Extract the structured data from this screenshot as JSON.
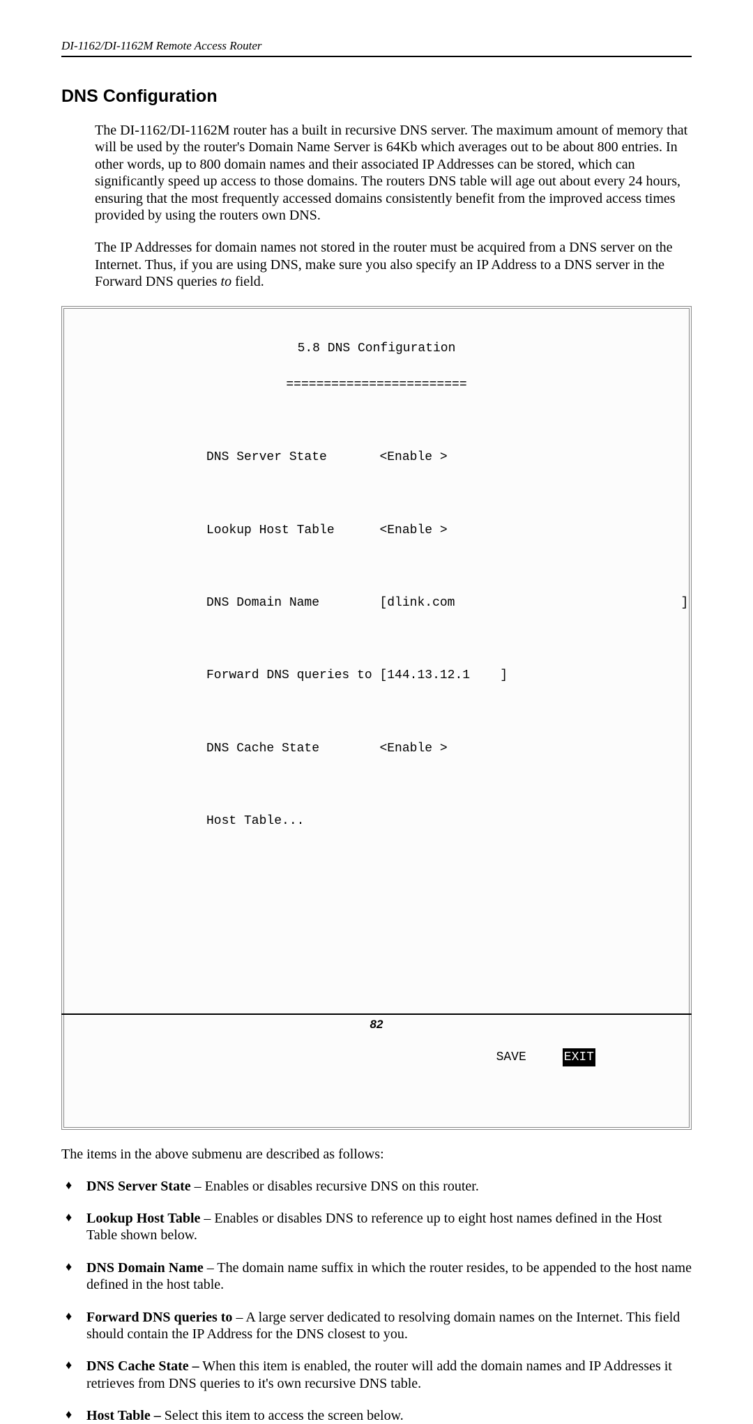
{
  "header": {
    "doc_title": "DI-1162/DI-1162M Remote Access Router"
  },
  "section": {
    "title": "DNS Configuration",
    "para1": "The DI-1162/DI-1162M router has a built in recursive DNS server. The maximum amount of memory that will be used by the router's Domain Name Server is 64Kb which averages out to be about 800 entries. In other words, up to 800 domain names and their associated IP Addresses can be stored, which can significantly speed up access to those domains. The routers DNS table will age out about every 24 hours, ensuring that the most frequently accessed domains consistently benefit from the improved access times provided by using the routers own DNS.",
    "para2_a": "The IP Addresses for domain names not stored in the router must be acquired from a DNS server on the Internet. Thus, if you are using DNS, make sure you also specify an IP Address to a DNS server in the Forward DNS queries ",
    "para2_ital": "to",
    "para2_b": " field."
  },
  "terminal": {
    "title": "5.8 DNS Configuration",
    "underline": "========================",
    "rows": {
      "server_state_label": "DNS Server State",
      "server_state_value": "<Enable >",
      "lookup_label": "Lookup Host Table",
      "lookup_value": "<Enable >",
      "domain_label": "DNS Domain Name",
      "domain_value": "[dlink.com",
      "domain_close": "]",
      "forward_label": "Forward DNS queries to",
      "forward_value": "[144.13.12.1    ]",
      "cache_label": "DNS Cache State",
      "cache_value": "<Enable >",
      "host_table": "Host Table..."
    },
    "save": "SAVE",
    "exit": "EXIT"
  },
  "after_terminal": "The items in the above submenu are described as follows:",
  "bullets": [
    {
      "bold": "DNS Server State",
      "rest": " – Enables or disables recursive DNS on this router."
    },
    {
      "bold": "Lookup Host Table",
      "rest": " – Enables or disables DNS to reference up to eight host names defined in the Host Table shown below."
    },
    {
      "bold": "DNS Domain Name",
      "rest": " – The domain name suffix in which the router resides, to be appended to the host name defined in the host table."
    },
    {
      "bold": "Forward DNS queries to",
      "rest": " – A large server dedicated to resolving domain names on the Internet. This field should contain the IP Address for the DNS closest to you."
    },
    {
      "bold": "DNS Cache State –",
      "rest": " When this item is enabled, the router will add the domain names and IP Addresses it retrieves from DNS queries to it's own recursive DNS table."
    },
    {
      "bold": "Host Table –",
      "rest": " Select this item to access the screen below."
    }
  ],
  "footer": {
    "page_number": "82"
  }
}
